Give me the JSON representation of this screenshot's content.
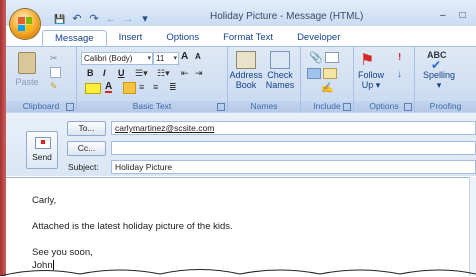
{
  "window": {
    "title": "Holiday Picture - Message (HTML)",
    "minimize": "–",
    "maximize": "□"
  },
  "qat": {
    "save": "💾",
    "undo": "↶",
    "redo": "↷",
    "prev": "←",
    "next": "→",
    "customize": "▾"
  },
  "tabs": [
    {
      "label": "Message"
    },
    {
      "label": "Insert"
    },
    {
      "label": "Options"
    },
    {
      "label": "Format Text"
    },
    {
      "label": "Developer"
    }
  ],
  "ribbon": {
    "clipboard": {
      "label": "Clipboard",
      "paste": "Paste"
    },
    "basic_text": {
      "label": "Basic Text",
      "font": "Calibri (Body)",
      "size": "11",
      "bold": "B",
      "italic": "I",
      "underline": "U",
      "grow": "A",
      "shrink": "A"
    },
    "names": {
      "label": "Names",
      "address_book": "Address Book",
      "address_line1": "Address",
      "address_line2": "Book",
      "check_line1": "Check",
      "check_line2": "Names"
    },
    "include": {
      "label": "Include"
    },
    "options": {
      "label": "Options",
      "follow_line1": "Follow",
      "follow_line2": "Up ▾"
    },
    "proofing": {
      "label": "Proofing",
      "spelling_line1": "Spelling",
      "spelling_line2": "▾",
      "abc": "ABC"
    }
  },
  "compose": {
    "send_label": "Send",
    "to_label": "To...",
    "cc_label": "Cc...",
    "subject_label": "Subject:",
    "to_value": "carlymartinez@scsite.com",
    "cc_value": "",
    "subject_value": "Holiday Picture"
  },
  "body": {
    "greeting": "Carly,",
    "line1": "Attached is the latest holiday picture of the kids.",
    "closing": "See you soon,",
    "signature": "John"
  },
  "colors": {
    "accent": "#15428b",
    "ribbon": "#c7d9f0",
    "frame": "#a83030"
  }
}
